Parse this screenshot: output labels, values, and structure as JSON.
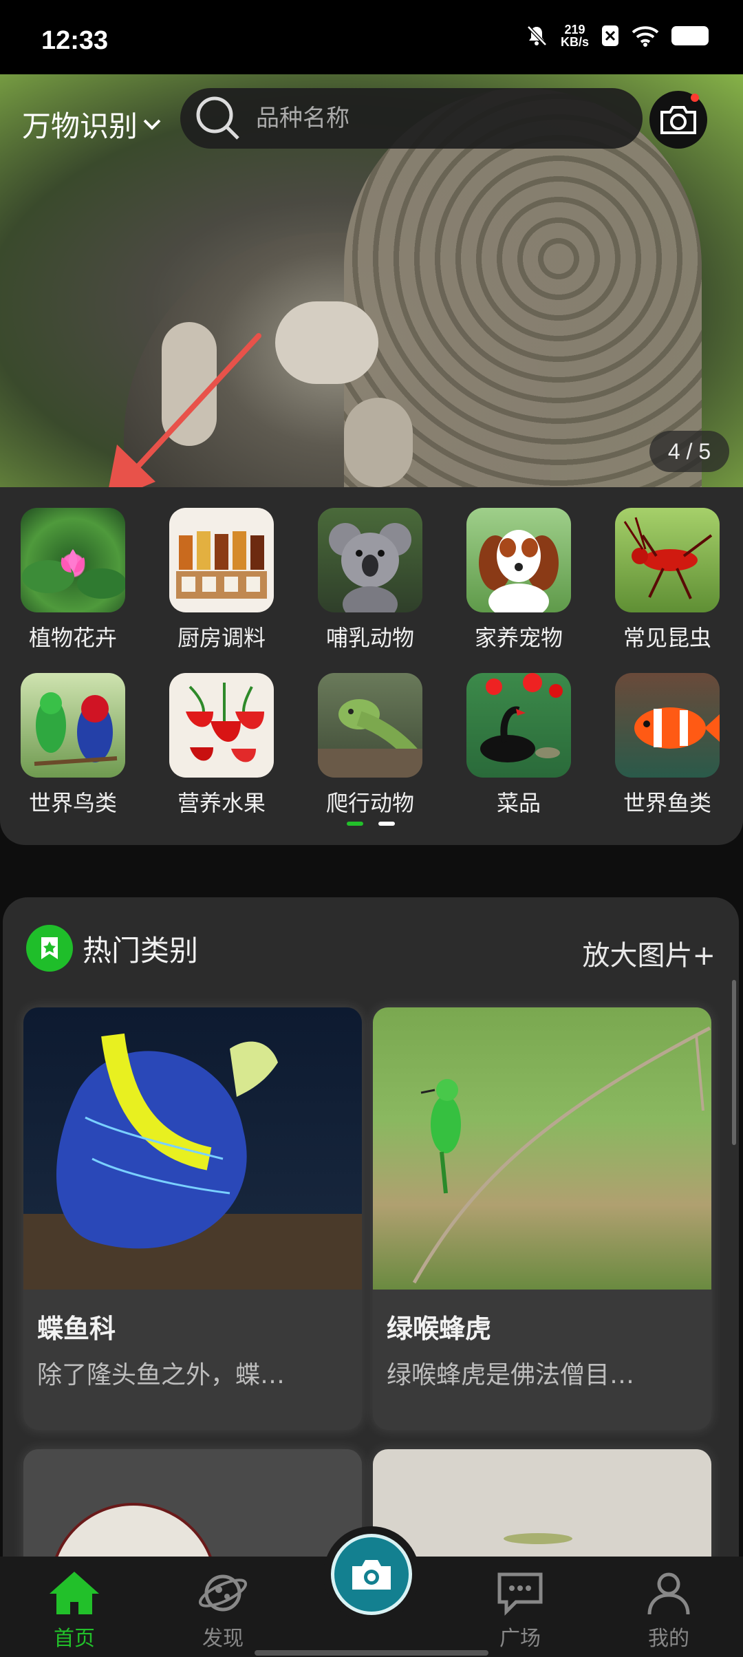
{
  "status_bar": {
    "time": "12:33",
    "net_speed": "219",
    "net_unit": "KB/s"
  },
  "header": {
    "mode_label": "万物识别",
    "search_placeholder": "品种名称"
  },
  "banner": {
    "pager": "4 / 5"
  },
  "categories": [
    {
      "label": "植物花卉",
      "icon": "lotus-flower"
    },
    {
      "label": "厨房调料",
      "icon": "spice-rack"
    },
    {
      "label": "哺乳动物",
      "icon": "koala"
    },
    {
      "label": "家养宠物",
      "icon": "dog"
    },
    {
      "label": "常见昆虫",
      "icon": "insect"
    },
    {
      "label": "世界鸟类",
      "icon": "parrot"
    },
    {
      "label": "营养水果",
      "icon": "strawberry"
    },
    {
      "label": "爬行动物",
      "icon": "iguana"
    },
    {
      "label": "菜品",
      "icon": "black-swan"
    },
    {
      "label": "世界鱼类",
      "icon": "clownfish"
    }
  ],
  "hot_section": {
    "title": "热门类别",
    "zoom_link": "放大图片+",
    "cards": [
      {
        "title": "蝶鱼科",
        "desc": "除了隆头鱼之外，蝶…"
      },
      {
        "title": "绿喉蜂虎",
        "desc": "绿喉蜂虎是佛法僧目…"
      }
    ]
  },
  "bottom_nav": [
    {
      "label": "首页",
      "icon": "home-icon",
      "active": true
    },
    {
      "label": "发现",
      "icon": "planet-icon",
      "active": false
    },
    {
      "label": "广场",
      "icon": "chat-icon",
      "active": false
    },
    {
      "label": "我的",
      "icon": "user-icon",
      "active": false
    }
  ],
  "colors": {
    "accent": "#22c02a",
    "panel": "#2b2b2b",
    "background": "#0e0e0e",
    "annotation_arrow": "#e8524a"
  }
}
